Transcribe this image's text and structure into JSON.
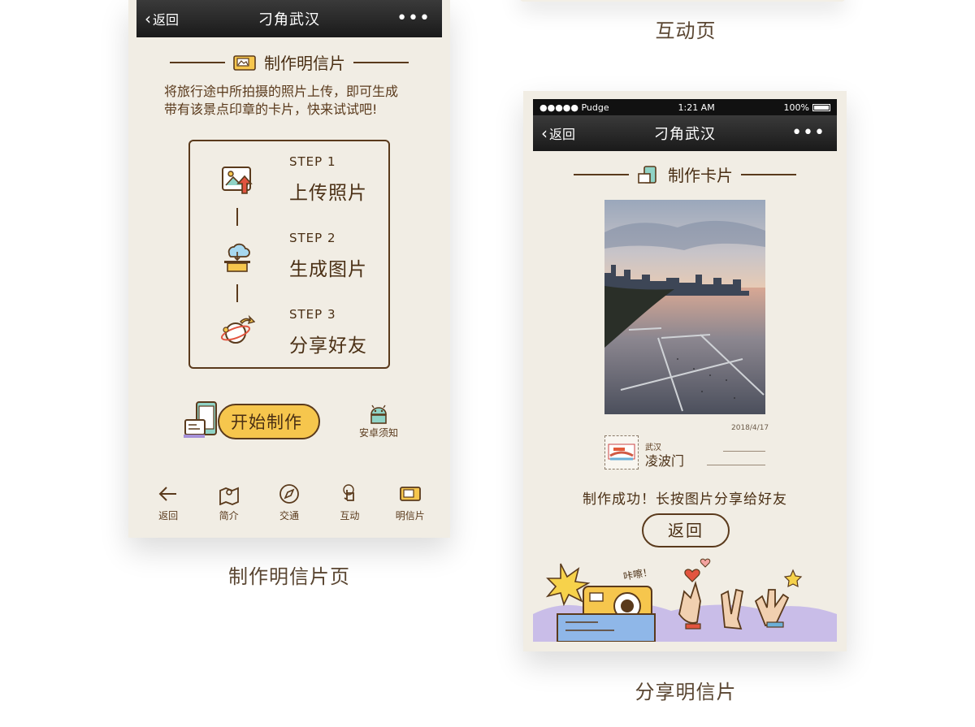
{
  "captions": {
    "top_right": "互动页",
    "left": "制作明信片页",
    "right": "分享明信片"
  },
  "left_phone": {
    "nav": {
      "back": "返回",
      "title": "刁角武汉",
      "more": "•••"
    },
    "section_title": "制作明信片",
    "intro_line1": "将旅行途中所拍摄的照片上传，即可生成",
    "intro_line2": "带有该景点印章的卡片，快来试试吧!",
    "steps": [
      {
        "num": "STEP 1",
        "label": "上传照片",
        "icon": "upload-photo-icon"
      },
      {
        "num": "STEP 2",
        "label": "生成图片",
        "icon": "cloud-print-icon"
      },
      {
        "num": "STEP 3",
        "label": "分享好友",
        "icon": "share-planet-icon"
      }
    ],
    "start_button": "开始制作",
    "android_notice": "安卓须知",
    "tabs": [
      {
        "label": "返回",
        "icon": "back-arrow-icon"
      },
      {
        "label": "简介",
        "icon": "map-pin-icon"
      },
      {
        "label": "交通",
        "icon": "compass-icon"
      },
      {
        "label": "互动",
        "icon": "touch-icon"
      },
      {
        "label": "明信片",
        "icon": "postcard-icon"
      }
    ]
  },
  "right_phone": {
    "status": {
      "carrier": "●●●●● Pudge",
      "time": "1:21 AM",
      "battery": "100%"
    },
    "nav": {
      "back": "返回",
      "title": "刁角武汉",
      "more": "•••"
    },
    "section_title": "制作卡片",
    "photo_date": "2018/4/17",
    "stamp_city": "武汉",
    "stamp_name": "凌波门",
    "success_text": "制作成功！长按图片分享给好友",
    "back_button": "返回",
    "illustration_text": "咔嚓！"
  },
  "colors": {
    "background": "#f1ede4",
    "brown": "#5a3a1c",
    "yellow": "#f6c64d",
    "nav_dark": "#1a1a1a"
  }
}
